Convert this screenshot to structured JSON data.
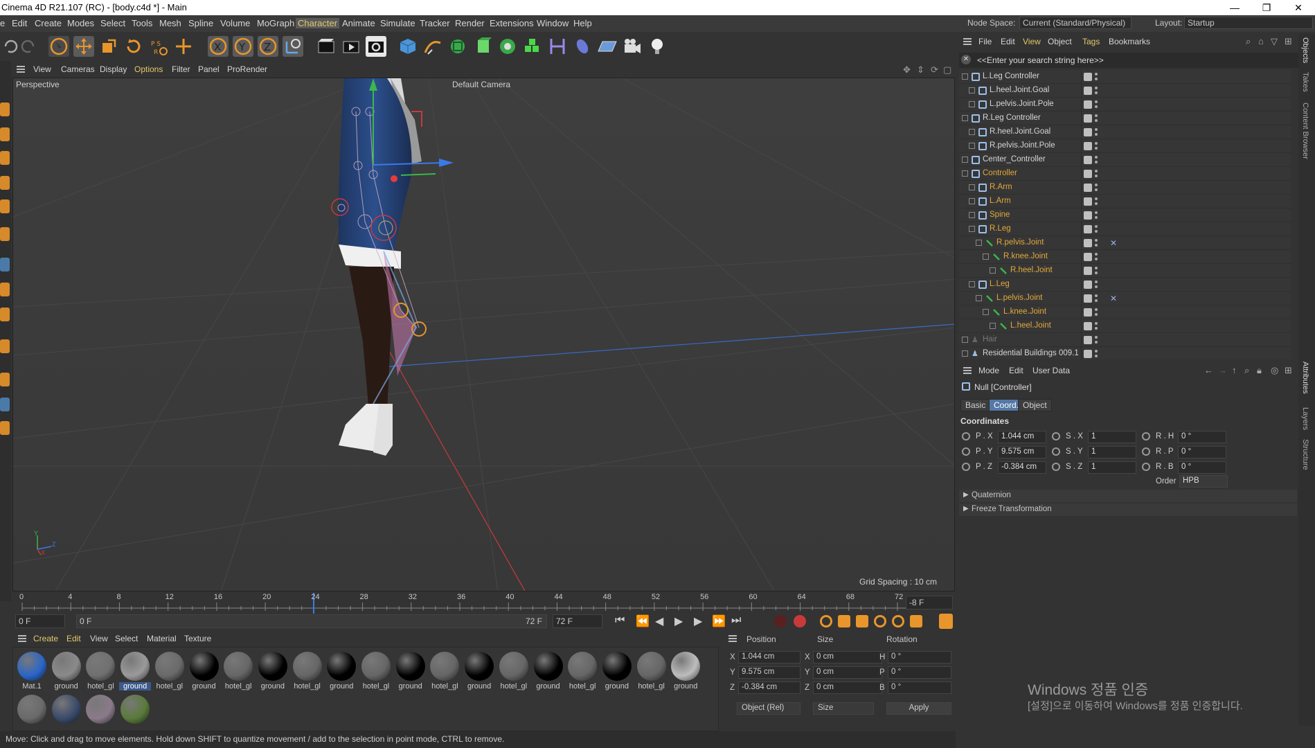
{
  "window": {
    "title": "Cinema 4D R21.107 (RC) - [body.c4d *] - Main",
    "controls": [
      "—",
      "❐",
      "✕"
    ]
  },
  "menubar": {
    "items": [
      "e",
      "Edit",
      "Create",
      "Modes",
      "Select",
      "Tools",
      "Mesh",
      "Spline",
      "Volume",
      "MoGraph",
      "Character",
      "Animate",
      "Simulate",
      "Tracker",
      "Render",
      "Extensions",
      "Window",
      "Help"
    ],
    "active": "Character",
    "node_space_label": "Node Space:",
    "node_space_value": "Current (Standard/Physical)",
    "layout_label": "Layout:",
    "layout_value": "Startup"
  },
  "viewport": {
    "menu": [
      "View",
      "Cameras",
      "Display",
      "Options",
      "Filter",
      "Panel",
      "ProRender"
    ],
    "active_menu": "Options",
    "projection": "Perspective",
    "camera": "Default Camera",
    "grid_spacing": "Grid Spacing : 10 cm",
    "axis_labels": {
      "y": "Y",
      "z": "Z",
      "x": "X"
    }
  },
  "timeline": {
    "ticks": [
      "0",
      "4",
      "8",
      "12",
      "16",
      "20",
      "24",
      "28",
      "32",
      "36",
      "40",
      "44",
      "48",
      "52",
      "56",
      "60",
      "64",
      "68",
      "72"
    ],
    "current_frame_field": "-8 F",
    "start_field": "0 F",
    "range_start": "0 F",
    "range_end": "72 F",
    "end_field": "72 F"
  },
  "materials": {
    "menu": [
      "Create",
      "Edit",
      "View",
      "Select",
      "Material",
      "Texture"
    ],
    "row1": [
      {
        "label": "Mat.1",
        "color": "#2a66c8",
        "selected": false
      },
      {
        "label": "ground",
        "color": "#8a8a8a",
        "selected": false
      },
      {
        "label": "hotel_gl",
        "color": "#707070",
        "selected": false
      },
      {
        "label": "ground",
        "color": "#9a9a9a",
        "selected": true
      },
      {
        "label": "hotel_gl",
        "color": "#6a6a6a",
        "selected": false
      },
      {
        "label": "ground",
        "color": "#000000",
        "selected": false
      },
      {
        "label": "hotel_gl",
        "color": "#666666",
        "selected": false
      },
      {
        "label": "ground",
        "color": "#000000",
        "selected": false
      },
      {
        "label": "hotel_gl",
        "color": "#666666",
        "selected": false
      },
      {
        "label": "ground",
        "color": "#000000",
        "selected": false
      },
      {
        "label": "hotel_gl",
        "color": "#666666",
        "selected": false
      },
      {
        "label": "ground",
        "color": "#000000",
        "selected": false
      },
      {
        "label": "hotel_gl",
        "color": "#666666",
        "selected": false
      },
      {
        "label": "ground",
        "color": "#000000",
        "selected": false
      },
      {
        "label": "hotel_gl",
        "color": "#666666",
        "selected": false
      },
      {
        "label": "ground",
        "color": "#000000",
        "selected": false
      },
      {
        "label": "hotel_gl",
        "color": "#666666",
        "selected": false
      },
      {
        "label": "ground",
        "color": "#000000",
        "selected": false
      },
      {
        "label": "hotel_gl",
        "color": "#666666",
        "selected": false
      },
      {
        "label": "ground",
        "color": "#bdbdbd",
        "selected": false
      }
    ],
    "row2": [
      {
        "label": "",
        "color": "#6a6a6a"
      },
      {
        "label": "",
        "color": "#3a4a6a"
      },
      {
        "label": "",
        "color": "#8a7a8a"
      },
      {
        "label": "",
        "color": "#5a7a3a"
      }
    ]
  },
  "coordinates": {
    "headers": [
      "Position",
      "Size",
      "Rotation"
    ],
    "rows": [
      {
        "axis": "X",
        "pos": "1.044 cm",
        "size_axis": "X",
        "size": "0 cm",
        "rot_axis": "H",
        "rot": "0 °"
      },
      {
        "axis": "Y",
        "pos": "9.575 cm",
        "size_axis": "Y",
        "size": "0 cm",
        "rot_axis": "P",
        "rot": "0 °"
      },
      {
        "axis": "Z",
        "pos": "-0.384 cm",
        "size_axis": "Z",
        "size": "0 cm",
        "rot_axis": "B",
        "rot": "0 °"
      }
    ],
    "mode_select": "Object (Rel)",
    "size_select": "Size",
    "apply": "Apply"
  },
  "status": "Move: Click and drag to move elements. Hold down SHIFT to quantize movement / add to the selection in point mode, CTRL to remove.",
  "object_manager": {
    "menu": [
      "File",
      "Edit",
      "View",
      "Object",
      "Tags",
      "Bookmarks"
    ],
    "search_placeholder": "<<Enter your search string here>>",
    "rows": [
      {
        "name": "L.Leg Controller",
        "indent": 0,
        "type": "null",
        "color": "white"
      },
      {
        "name": "L.heel.Joint.Goal",
        "indent": 1,
        "type": "null",
        "color": "white"
      },
      {
        "name": "L.pelvis.Joint.Pole",
        "indent": 1,
        "type": "null",
        "color": "white"
      },
      {
        "name": "R.Leg Controller",
        "indent": 0,
        "type": "null",
        "color": "white"
      },
      {
        "name": "R.heel.Joint.Goal",
        "indent": 1,
        "type": "null",
        "color": "white"
      },
      {
        "name": "R.pelvis.Joint.Pole",
        "indent": 1,
        "type": "null",
        "color": "white"
      },
      {
        "name": "Center_Controller",
        "indent": 0,
        "type": "null",
        "color": "white"
      },
      {
        "name": "Controller",
        "indent": 0,
        "type": "null",
        "color": "orange"
      },
      {
        "name": "R.Arm",
        "indent": 1,
        "type": "null",
        "color": "orange"
      },
      {
        "name": "L.Arm",
        "indent": 1,
        "type": "null",
        "color": "orange"
      },
      {
        "name": "Spine",
        "indent": 1,
        "type": "null",
        "color": "orange"
      },
      {
        "name": "R.Leg",
        "indent": 1,
        "type": "null",
        "color": "orange"
      },
      {
        "name": "R.pelvis.Joint",
        "indent": 2,
        "type": "joint",
        "color": "orange"
      },
      {
        "name": "R.knee.Joint",
        "indent": 3,
        "type": "joint",
        "color": "orange"
      },
      {
        "name": "R.heel.Joint",
        "indent": 4,
        "type": "joint",
        "color": "orange"
      },
      {
        "name": "L.Leg",
        "indent": 1,
        "type": "null",
        "color": "orange"
      },
      {
        "name": "L.pelvis.Joint",
        "indent": 2,
        "type": "joint",
        "color": "orange"
      },
      {
        "name": "L.knee.Joint",
        "indent": 3,
        "type": "joint",
        "color": "orange"
      },
      {
        "name": "L.heel.Joint",
        "indent": 4,
        "type": "joint",
        "color": "orange"
      },
      {
        "name": "Hair",
        "indent": 0,
        "type": "figure",
        "color": "grey"
      },
      {
        "name": "Residential Buildings 009.1",
        "indent": 0,
        "type": "figure",
        "color": "white"
      }
    ]
  },
  "attributes": {
    "menu": [
      "Mode",
      "Edit",
      "User Data"
    ],
    "object_title": "Null [Controller]",
    "tabs": [
      "Basic",
      "Coord.",
      "Object"
    ],
    "active_tab": "Coord.",
    "section": "Coordinates",
    "rows": [
      {
        "p_label": "P . X",
        "p": "1.044 cm",
        "s_label": "S . X",
        "s": "1",
        "r_label": "R . H",
        "r": "0 °"
      },
      {
        "p_label": "P . Y",
        "p": "9.575 cm",
        "s_label": "S . Y",
        "s": "1",
        "r_label": "R . P",
        "r": "0 °"
      },
      {
        "p_label": "P . Z",
        "p": "-0.384 cm",
        "s_label": "S . Z",
        "s": "1",
        "r_label": "R . B",
        "r": "0 °"
      }
    ],
    "order_label": "Order",
    "order_value": "HPB",
    "collapsibles": [
      "Quaternion",
      "Freeze Transformation"
    ]
  },
  "side_tabs_top": [
    "Objects",
    "Takes",
    "Content Browser"
  ],
  "side_tabs_bottom": [
    "Attributes",
    "Layers",
    "Structure"
  ],
  "watermark": {
    "line1": "Windows 정품 인증",
    "line2": "[설정]으로 이동하여 Windows를 정품 인증합니다."
  }
}
